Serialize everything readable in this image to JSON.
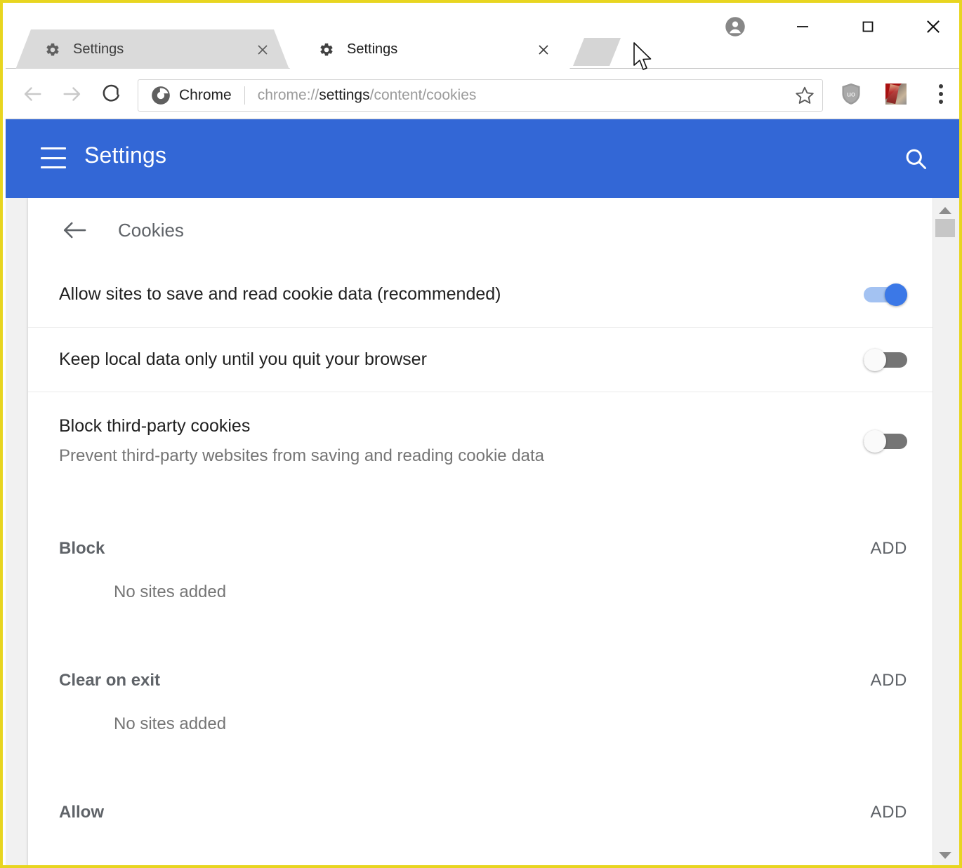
{
  "window": {
    "controls": {
      "profile_label": "profile-avatar",
      "minimize_label": "Minimize",
      "maximize_label": "Maximize",
      "close_label": "Close"
    }
  },
  "tabs": [
    {
      "title": "Settings",
      "favicon": "gear-icon",
      "active": false,
      "close_label": "Close tab"
    },
    {
      "title": "Settings",
      "favicon": "gear-icon",
      "active": true,
      "close_label": "Close tab"
    }
  ],
  "newtab": {
    "label": "New tab"
  },
  "toolbar": {
    "back_label": "Back",
    "forward_label": "Forward",
    "reload_label": "Reload",
    "chrome_badge": "Chrome",
    "url_prefix": "chrome://",
    "url_host": "settings",
    "url_path": "/content/cookies",
    "url_full": "chrome://settings/content/cookies",
    "star_label": "Bookmark this page",
    "extensions": [
      {
        "name": "uBlock Origin",
        "icon": "shield-icon",
        "badge_text": "uo"
      },
      {
        "name": "extension-thumbnail",
        "icon": "extension-icon"
      }
    ],
    "menu_label": "Customize and control Google Chrome"
  },
  "settings_header": {
    "menu_label": "Main menu",
    "title": "Settings",
    "search_label": "Search settings"
  },
  "subpage": {
    "back_label": "Back",
    "title": "Cookies"
  },
  "rows": [
    {
      "primary": "Allow sites to save and read cookie data (recommended)",
      "secondary": "",
      "toggle_state": "on",
      "toggle_name": "allow-cookies-toggle"
    },
    {
      "primary": "Keep local data only until you quit your browser",
      "secondary": "",
      "toggle_state": "off",
      "toggle_name": "keep-local-data-toggle"
    },
    {
      "primary": "Block third-party cookies",
      "secondary": "Prevent third-party websites from saving and reading cookie data",
      "toggle_state": "off",
      "toggle_name": "block-third-party-toggle"
    }
  ],
  "sections": [
    {
      "title": "Block",
      "add_label": "ADD",
      "empty_text": "No sites added"
    },
    {
      "title": "Clear on exit",
      "add_label": "ADD",
      "empty_text": "No sites added"
    },
    {
      "title": "Allow",
      "add_label": "ADD",
      "empty_text": ""
    }
  ],
  "scrollbar": {
    "up_label": "Scroll up",
    "down_label": "Scroll down",
    "thumb_label": "Scroll thumb"
  },
  "colors": {
    "header_blue": "#3367d6",
    "toggle_on": "#3b78e7",
    "toggle_on_track": "#a3c2f2",
    "toggle_off_track": "#757575",
    "window_highlight": "#e8d520",
    "primary_text": "#212121",
    "secondary_text": "#757575",
    "section_text": "#5f6368"
  }
}
